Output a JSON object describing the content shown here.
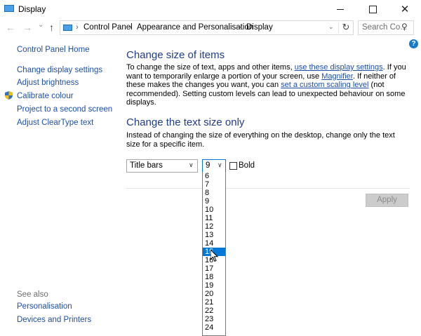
{
  "window": {
    "title": "Display"
  },
  "nav": {
    "breadcrumb": [
      "Control Panel",
      "Appearance and Personalisation",
      "Display"
    ],
    "search_placeholder": "Search Co..."
  },
  "sidebar": {
    "home": "Control Panel Home",
    "items": [
      "Change display settings",
      "Adjust brightness",
      "Calibrate colour",
      "Project to a second screen",
      "Adjust ClearType text"
    ],
    "see_also_label": "See also",
    "see_also": [
      "Personalisation",
      "Devices and Printers"
    ]
  },
  "main": {
    "section1_title": "Change size of items",
    "p1": {
      "t1": "To change the size of text, apps and other items, ",
      "link1": "use these display settings",
      "t2": ". If you want to temporarily enlarge a portion of your screen, use ",
      "link2": "Magnifier",
      "t3": ". If neither of these makes the changes you want, you can ",
      "link3": "set a custom scaling level",
      "t4": " (not recommended). Setting custom levels can lead to unexpected behaviour on some displays."
    },
    "section2_title": "Change the text size only",
    "p2": "Instead of changing the size of everything on the desktop, change only the text size for a specific item.",
    "item_select_value": "Title bars",
    "size_select_value": "9",
    "bold_label": "Bold",
    "bold_checked": false,
    "apply_label": "Apply",
    "size_options": [
      "6",
      "7",
      "8",
      "9",
      "10",
      "11",
      "12",
      "13",
      "14",
      "15",
      "16",
      "17",
      "18",
      "19",
      "20",
      "21",
      "22",
      "23",
      "24"
    ],
    "highlighted_option": "15"
  },
  "colors": {
    "accent": "#0078d7",
    "heading": "#1e3c8c",
    "link": "#1c4eab"
  }
}
